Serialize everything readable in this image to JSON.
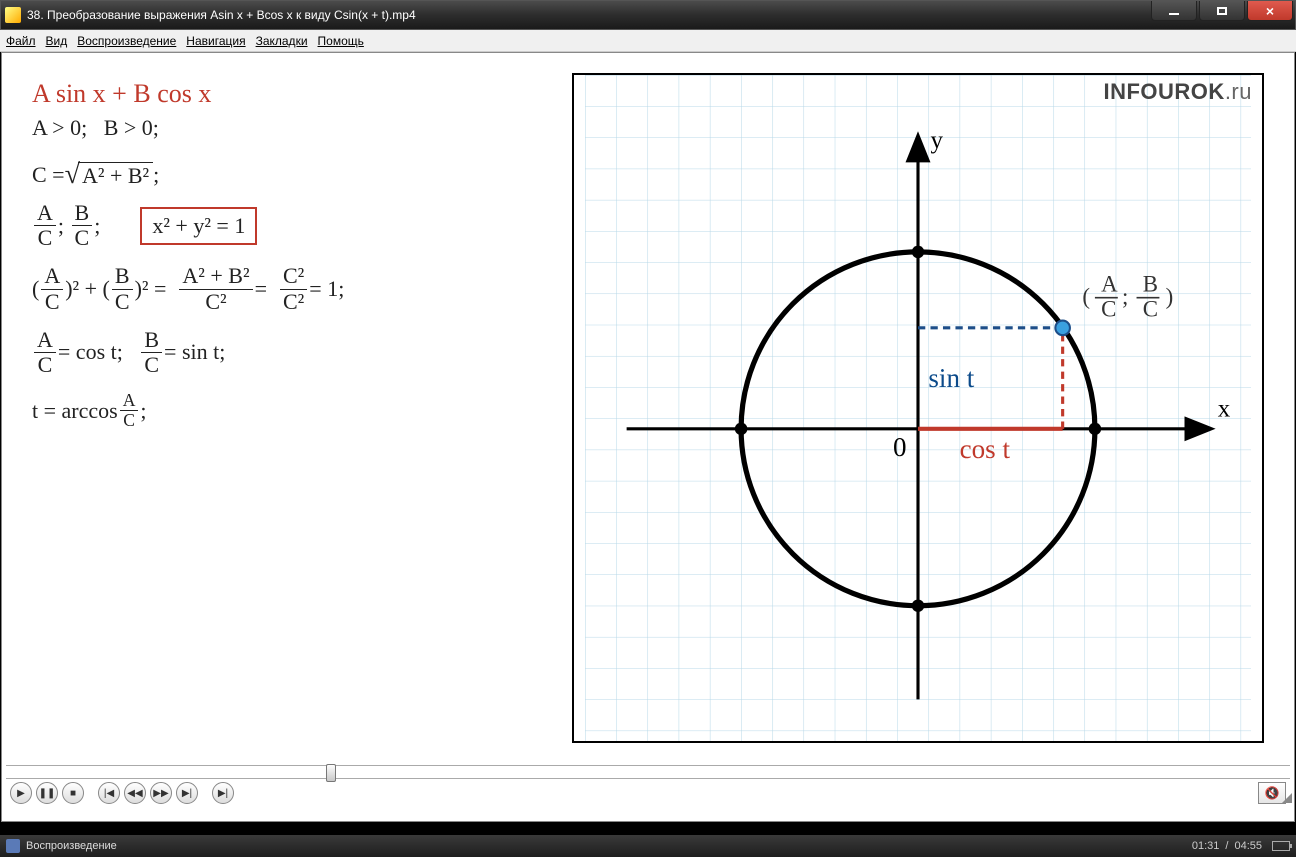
{
  "window": {
    "title": "38. Преобразование выражения Asin x + Bcos x к виду Csin(x + t).mp4"
  },
  "menu": {
    "file": "Файл",
    "view": "Вид",
    "playback": "Воспроизведение",
    "navigation": "Навигация",
    "bookmarks": "Закладки",
    "help": "Помощь"
  },
  "status": {
    "label": "Воспроизведение",
    "current_time": "01:31",
    "total_time": "04:55"
  },
  "content": {
    "logo_main": "INFOUROK",
    "logo_suffix": ".ru",
    "formula_title": "A sin x + B cos x",
    "cond_a": "A > 0;",
    "cond_b": "B > 0;",
    "c_eq": "C = ",
    "c_radicand": "A² + B²",
    "boxed": "x² + y² = 1",
    "eq_sum": "A² + B²",
    "eq_c2": "C²",
    "eq_c2b": "C²",
    "eq_c2c": "C²",
    "eq_one": " = 1;",
    "cos_t": " = cos t;",
    "sin_t": " = sin t;",
    "t_eq": "t = arccos ",
    "semicolon": " ;",
    "A": "A",
    "B": "B",
    "C": "C"
  },
  "graph": {
    "x_label": "x",
    "y_label": "y",
    "origin": "0",
    "cos_label": "cos t",
    "sin_label": "sin t",
    "point_A": "A",
    "point_B": "B",
    "point_C": "C"
  },
  "chart_data": {
    "type": "diagram",
    "title": "Unit circle with point (A/C; B/C)",
    "radius": 1,
    "point": {
      "x_desc": "A/C = cos t",
      "y_desc": "B/C = sin t",
      "approx_angle_deg": 35
    },
    "axes": {
      "xlabel": "x",
      "ylabel": "y"
    },
    "annotations": [
      "sin t",
      "cos t",
      "(A/C ; B/C)",
      "0"
    ]
  }
}
